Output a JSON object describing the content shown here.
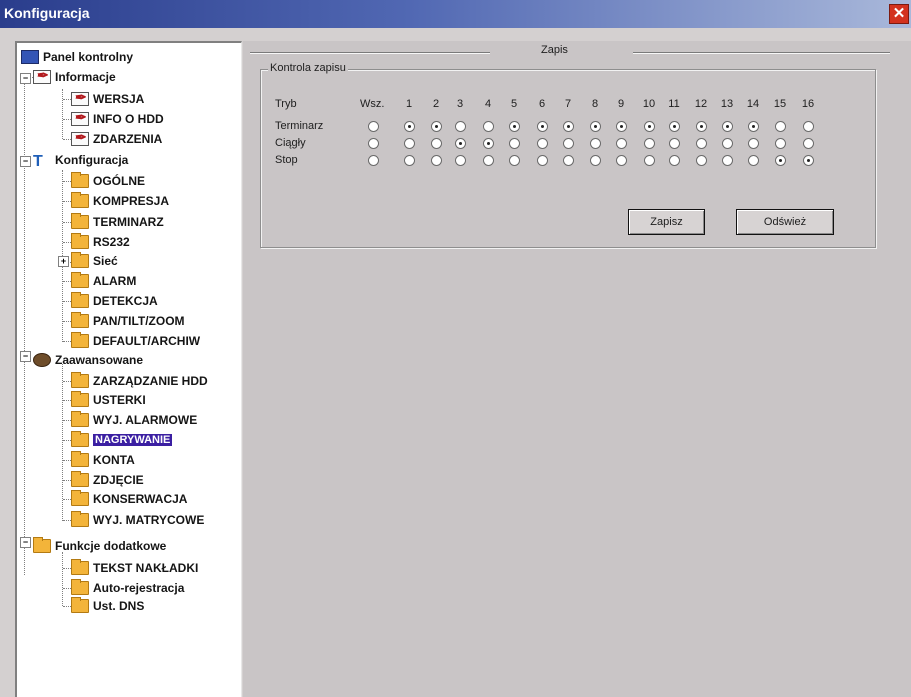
{
  "window": {
    "title": "Konfiguracja",
    "close_icon": "close-icon"
  },
  "tree": {
    "root": "Panel kontrolny",
    "informacje": {
      "label": "Informacje",
      "children": [
        "WERSJA",
        "INFO O HDD",
        "ZDARZENIA"
      ]
    },
    "konfiguracja": {
      "label": "Konfiguracja",
      "children": [
        "OGÓLNE",
        "KOMPRESJA",
        "TERMINARZ",
        "RS232",
        "Sieć",
        "ALARM",
        "DETEKCJA",
        "PAN/TILT/ZOOM",
        "DEFAULT/ARCHIW"
      ]
    },
    "zaawansowane": {
      "label": "Zaawansowane",
      "children": [
        "ZARZĄDZANIE HDD",
        "USTERKI",
        "WYJ. ALARMOWE",
        "NAGRYWANIE",
        "KONTA",
        "ZDJĘCIE",
        "KONSERWACJA",
        "WYJ. MATRYCOWE"
      ]
    },
    "funkcje": {
      "label": "Funkcje dodatkowe",
      "children": [
        "TEKST NAKŁADKI",
        "Auto-rejestracja",
        "Ust. DNS"
      ]
    },
    "selected": "NAGRYWANIE"
  },
  "panel": {
    "header": "Zapis",
    "group_title": "Kontrola zapisu",
    "mode_label": "Tryb",
    "all_label": "Wsz.",
    "channels": [
      "1",
      "2",
      "3",
      "4",
      "5",
      "6",
      "7",
      "8",
      "9",
      "10",
      "11",
      "12",
      "13",
      "14",
      "15",
      "16"
    ],
    "rows": [
      {
        "label": "Terminarz",
        "all": false,
        "values": [
          true,
          true,
          false,
          false,
          true,
          true,
          true,
          true,
          true,
          true,
          true,
          true,
          true,
          true,
          false,
          false
        ]
      },
      {
        "label": "Ciągły",
        "all": false,
        "values": [
          false,
          false,
          true,
          true,
          false,
          false,
          false,
          false,
          false,
          false,
          false,
          false,
          false,
          false,
          false,
          false
        ]
      },
      {
        "label": "Stop",
        "all": false,
        "values": [
          false,
          false,
          false,
          false,
          false,
          false,
          false,
          false,
          false,
          false,
          false,
          false,
          false,
          false,
          true,
          true
        ]
      }
    ],
    "buttons": {
      "save": "Zapisz",
      "refresh": "Odśwież"
    }
  }
}
